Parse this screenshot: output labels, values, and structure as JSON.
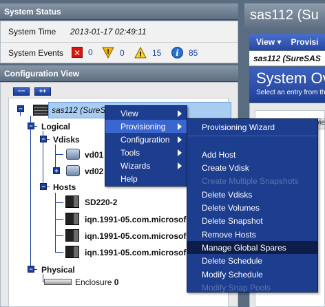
{
  "system_status": {
    "title": "System Status",
    "time_label": "System Time",
    "time_value": "2013-01-17 02:49:11",
    "events_label": "System Events",
    "events": [
      {
        "icon": "critical-x-icon",
        "count": "0"
      },
      {
        "icon": "error-shield-icon",
        "count": "0"
      },
      {
        "icon": "warning-triangle-icon",
        "count": "15"
      },
      {
        "icon": "info-icon",
        "count": "85"
      }
    ]
  },
  "config_view": {
    "title": "Configuration View",
    "collapse_all": "−−",
    "expand_all": "++",
    "tree": {
      "root": "sas112 (SureS",
      "logical": "Logical",
      "vdisks": "Vdisks",
      "vd01": "vd01",
      "vd02": "vd02",
      "hosts": "Hosts",
      "host_items": [
        "SD220-2",
        "iqn.1991-05.com.microsof",
        "iqn.1991-05.com.microsof",
        "iqn.1991-05.com.microsof"
      ],
      "physical": "Physical",
      "enclosure_label": "Enclosure",
      "enclosure_num": "0"
    }
  },
  "context_menu": {
    "items": [
      "View",
      "Provisioning",
      "Configuration",
      "Tools",
      "Wizards",
      "Help"
    ],
    "highlighted": "Provisioning"
  },
  "provisioning_submenu": {
    "items": [
      {
        "label": "Provisioning Wizard",
        "disabled": false
      },
      {
        "label": "Add Host",
        "disabled": false
      },
      {
        "label": "Create Vdisk",
        "disabled": false
      },
      {
        "label": "Create Multiple Snapshots",
        "disabled": true
      },
      {
        "label": "Delete Vdisks",
        "disabled": false
      },
      {
        "label": "Delete Volumes",
        "disabled": false
      },
      {
        "label": "Delete Snapshot",
        "disabled": false
      },
      {
        "label": "Remove Hosts",
        "disabled": false
      },
      {
        "label": "Manage Global Spares",
        "disabled": false
      },
      {
        "label": "Delete Schedule",
        "disabled": false
      },
      {
        "label": "Modify Schedule",
        "disabled": false
      },
      {
        "label": "Modify Snap Pools",
        "disabled": true
      }
    ],
    "highlighted": "Manage Global Spares"
  },
  "right_panel": {
    "title": "sas112 (Su",
    "menu_view": "View",
    "menu_provisioning": "Provisi",
    "subtitle": "sas112 (SureSAS",
    "overview_title": "System Ov",
    "overview_hint": "Select an entry from th",
    "view_tab": "vie"
  },
  "colors": {
    "menu_bg": "#1d3d8f",
    "menu_highlight": "#3a67cf",
    "selection": "#a8ccf2",
    "panel_header": "#6b7b8e"
  }
}
